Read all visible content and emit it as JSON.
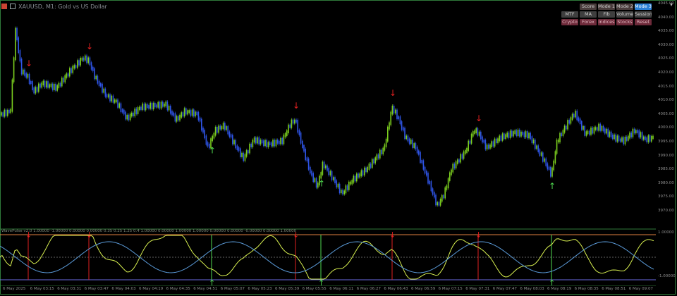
{
  "window": {
    "title": "XAUUSD, M1: Gold vs US Dollar"
  },
  "toolbar_buttons": [
    {
      "label": "Score",
      "row": 1
    },
    {
      "label": "Mode 1",
      "row": 1
    },
    {
      "label": "Mode 2",
      "row": 1
    },
    {
      "label": "Mode 3",
      "row": 1,
      "active": true
    },
    {
      "label": "MTF",
      "row": 2
    },
    {
      "label": "MA",
      "row": 2
    },
    {
      "label": "Fib",
      "row": 2
    },
    {
      "label": "Volume",
      "row": 2
    },
    {
      "label": "Session",
      "row": 2
    },
    {
      "label": "Crypto",
      "row": 3
    },
    {
      "label": "Forex",
      "row": 3
    },
    {
      "label": "Indices",
      "row": 3
    },
    {
      "label": "Stocks",
      "row": 3
    },
    {
      "label": "Reset",
      "row": 3
    }
  ],
  "price_axis": [
    "4045.00",
    "4040.00",
    "4035.00",
    "4030.00",
    "4025.00",
    "4020.00",
    "4015.00",
    "4010.00",
    "4005.00",
    "4000.00",
    "3995.00",
    "3990.00",
    "3985.00",
    "3980.00",
    "3975.00",
    "3970.00"
  ],
  "osc_axis": {
    "top": "1.00000",
    "bottom": "-1.00000"
  },
  "osc_label": "WavePulse v2.0  1.00000  -1.00000  0.00000  0.00000  0.35  0.25  1.25  0.4  1.00000  0.00000  1.00000  1.00000  0.00000  0.00000  -0.00000  0.00000  1.00000",
  "time_axis": [
    "6 May 2025",
    "6 May 03:15",
    "6 May 03:31",
    "6 May 03:47",
    "6 May 04:03",
    "6 May 04:19",
    "6 May 04:35",
    "6 May 04:51",
    "6 May 05:07",
    "6 May 05:23",
    "6 May 05:39",
    "6 May 05:55",
    "6 May 06:11",
    "6 May 06:27",
    "6 May 06:43",
    "6 May 06:59",
    "6 May 07:15",
    "6 May 07:31",
    "6 May 07:47",
    "6 May 08:03",
    "6 May 08:19",
    "6 May 08:35",
    "6 May 08:51",
    "6 May 09:07"
  ],
  "colors": {
    "bull": "#7ccf1f",
    "bear": "#2f55e8",
    "sell_arrow": "#e02020",
    "buy_arrow": "#4fd84f",
    "osc_fast": "#d8f050",
    "osc_slow": "#5a9ad8",
    "band_top": "#e08040",
    "band_bot": "#6a6adf"
  },
  "signals": {
    "sell": [
      40,
      126,
      419,
      556,
      678
    ],
    "buy": [
      300,
      455,
      782
    ]
  },
  "icons": [
    "chart-icon",
    "window-icon"
  ]
}
